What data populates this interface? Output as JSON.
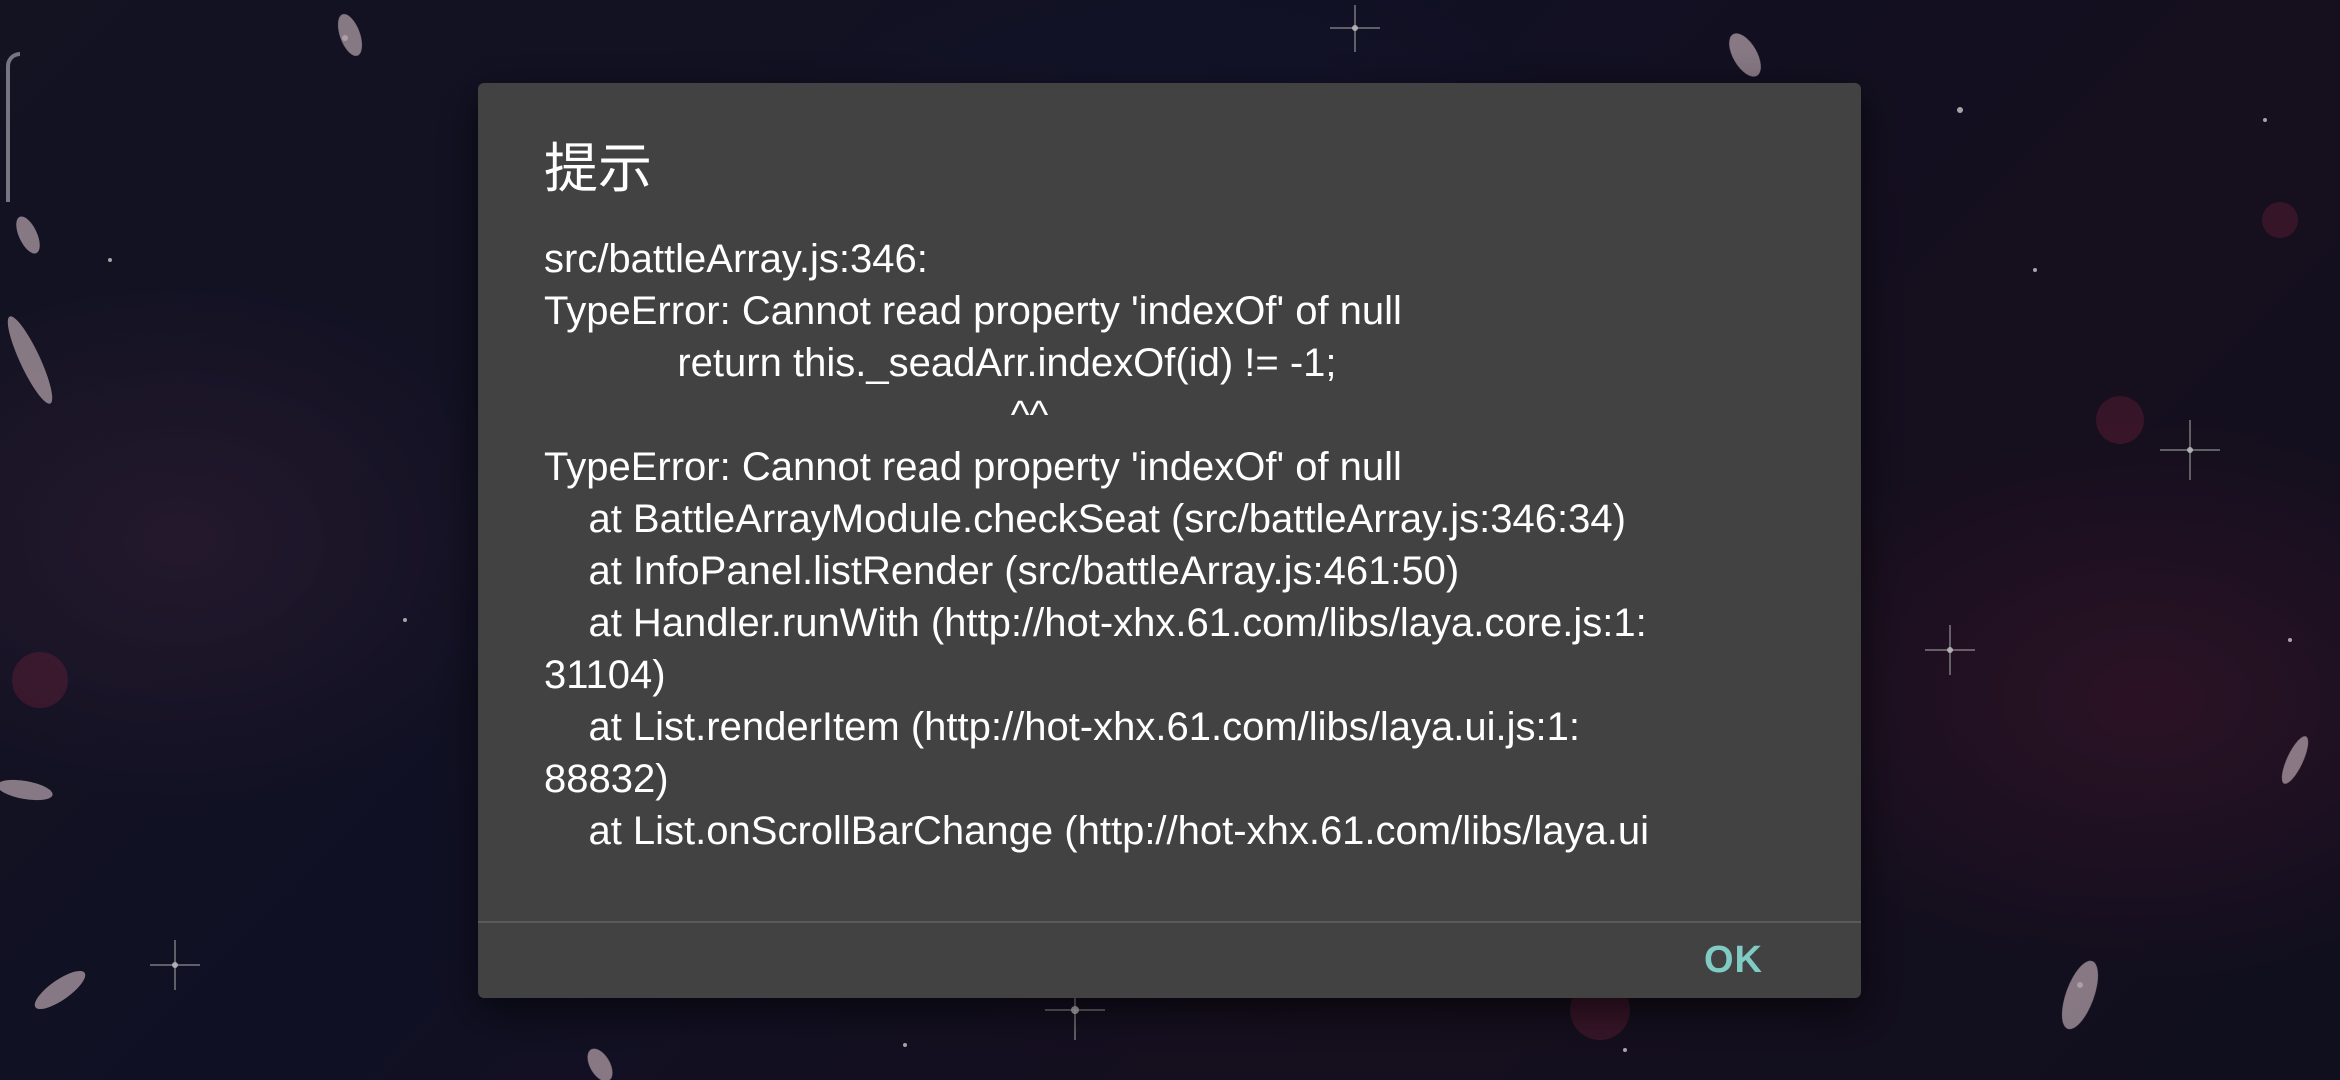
{
  "dialog": {
    "title": "提示",
    "message_lines": [
      "src/battleArray.js:346:",
      "TypeError: Cannot read property 'indexOf' of null",
      "            return this._seadArr.indexOf(id) != -1;",
      "                                          ^^",
      "TypeError: Cannot read property 'indexOf' of null",
      "    at BattleArrayModule.checkSeat (src/battleArray.js:346:34)",
      "    at InfoPanel.listRender (src/battleArray.js:461:50)",
      "    at Handler.runWith (http://hot-xhx.61.com/libs/laya.core.js:1:",
      "31104)",
      "    at List.renderItem (http://hot-xhx.61.com/libs/laya.ui.js:1:",
      "88832)",
      "    at List.onScrollBarChange (http://hot-xhx.61.com/libs/laya.ui"
    ],
    "ok_label": "OK"
  },
  "colors": {
    "dialog_bg": "#424242",
    "accent": "#80cbc4",
    "text": "#ffffff"
  },
  "icons": {
    "edge_handle": "edge-swipe-handle-icon"
  }
}
